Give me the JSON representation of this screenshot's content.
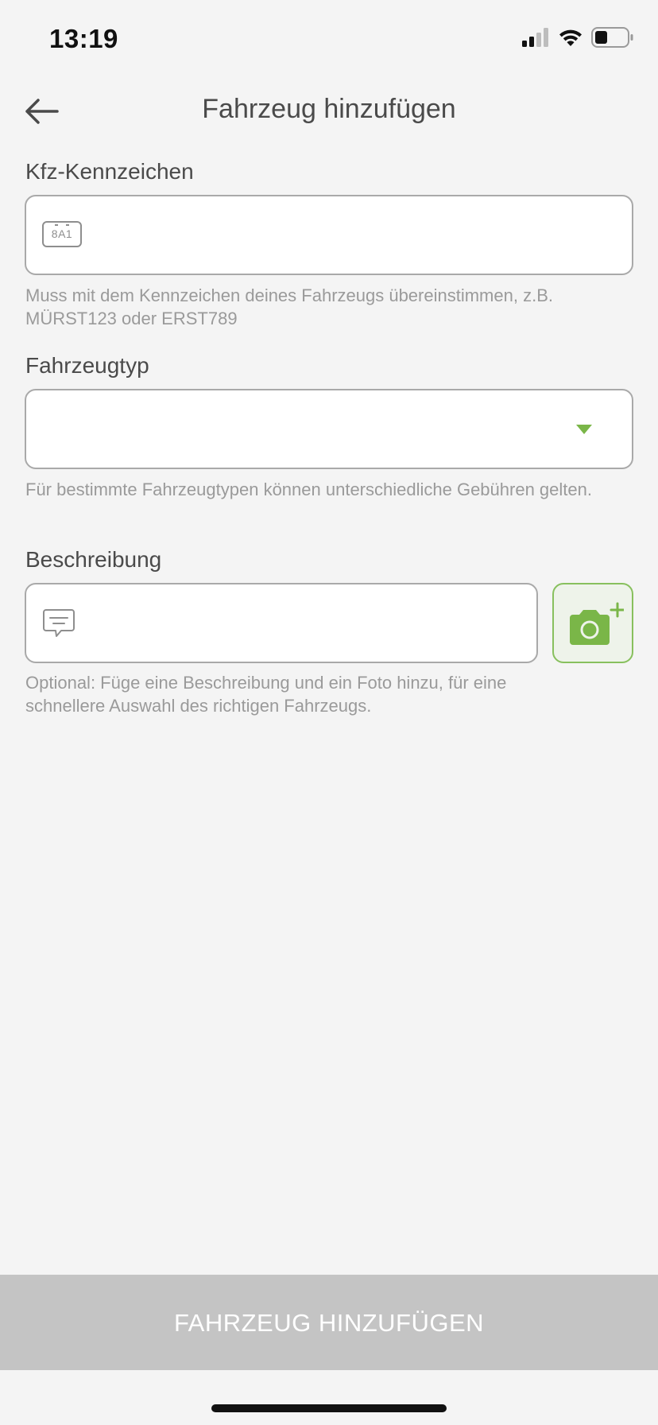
{
  "status_bar": {
    "time": "13:19",
    "signal_icon": "cellular-signal-icon",
    "wifi_icon": "wifi-icon",
    "battery_icon": "battery-icon"
  },
  "header": {
    "back_icon": "arrow-left-icon",
    "title": "Fahrzeug hinzufügen"
  },
  "plate_section": {
    "label": "Kfz-Kennzeichen",
    "icon": "license-plate-icon",
    "icon_text": "8A1",
    "value": "",
    "placeholder": "",
    "helper": "Muss mit dem Kennzeichen deines Fahrzeugs übereinstimmen, z.B. MÜRST123 oder ERST789"
  },
  "type_section": {
    "label": "Fahrzeugtyp",
    "selected": "",
    "dropdown_icon": "triangle-down-icon",
    "helper": "Für bestimmte Fahrzeugtypen können unterschiedliche Gebühren gelten."
  },
  "description_section": {
    "label": "Beschreibung",
    "icon": "comment-icon",
    "value": "",
    "placeholder": "",
    "photo_button_icon": "add-photo-icon",
    "helper": "Optional: Füge eine Beschreibung und ein Foto hinzu, für eine schnellere Auswahl des richtigen Fahrzeugs."
  },
  "submit": {
    "label": "FAHRZEUG HINZUFÜGEN"
  },
  "colors": {
    "accent": "#7ab648",
    "background": "#f4f4f4",
    "button_disabled": "#c4c4c4"
  }
}
